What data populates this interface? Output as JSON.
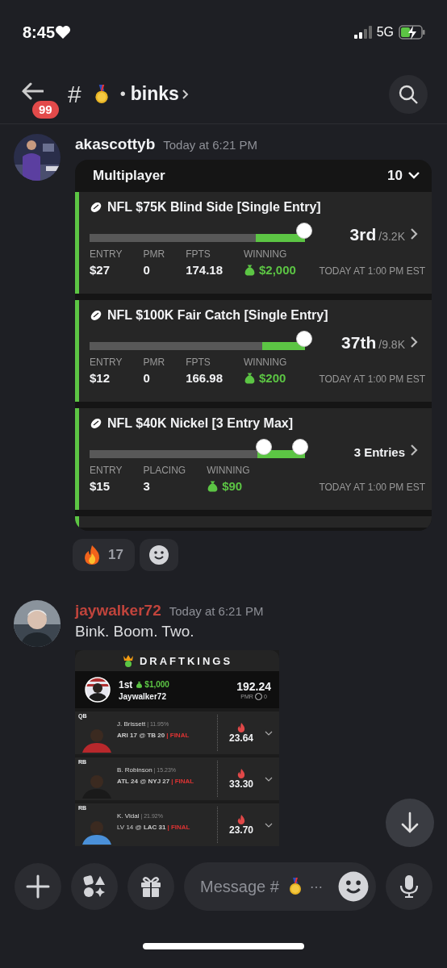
{
  "status_bar": {
    "time": "8:45",
    "network": "5G"
  },
  "header": {
    "unread_badge": "99",
    "hash": "#",
    "separator": "•",
    "channel": "binks"
  },
  "messages": [
    {
      "author": "akascottyb",
      "color": "#f2f3f5",
      "time": "Today at 6:21 PM",
      "kind": "contests",
      "contests_panel": {
        "title": "Multiplayer",
        "count": "10",
        "contests": [
          {
            "kind": "rank",
            "title": "NFL $75K Blind Side [Single Entry]",
            "level": 0.23,
            "rank": "3rd",
            "field": "/3.2K",
            "stats": [
              {
                "label": "ENTRY",
                "value": "$27",
                "kind": "plain"
              },
              {
                "label": "PMR",
                "value": "0",
                "kind": "plain"
              },
              {
                "label": "FPTS",
                "value": "174.18",
                "kind": "plain"
              },
              {
                "label": "WINNING",
                "value": "$2,000",
                "kind": "money"
              }
            ],
            "start": "TODAY AT 1:00 PM EST"
          },
          {
            "kind": "rank",
            "title": "NFL $100K Fair Catch [Single Entry]",
            "level": 0.2,
            "rank": "37th",
            "field": "/9.8K",
            "stats": [
              {
                "label": "ENTRY",
                "value": "$12",
                "kind": "plain"
              },
              {
                "label": "PMR",
                "value": "0",
                "kind": "plain"
              },
              {
                "label": "FPTS",
                "value": "166.98",
                "kind": "plain"
              },
              {
                "label": "WINNING",
                "value": "$200",
                "kind": "money"
              }
            ],
            "start": "TODAY AT 1:00 PM EST"
          },
          {
            "kind": "entries",
            "title": "NFL $40K Nickel [3 Entry Max]",
            "level": 0.22,
            "entries": "3 Entries",
            "stats": [
              {
                "label": "ENTRY",
                "value": "$15",
                "kind": "plain"
              },
              {
                "label": "PLACING",
                "value": "3",
                "kind": "plain"
              },
              {
                "label": "WINNING",
                "value": "$90",
                "kind": "money"
              }
            ],
            "start": "TODAY AT 1:00 PM EST"
          }
        ]
      },
      "reactions": [
        {
          "count": "17"
        }
      ]
    },
    {
      "author": "jaywalker72",
      "color": "#c1443c",
      "time": "Today at 6:21 PM",
      "kind": "lineup",
      "text": "Bink. Boom. Two.",
      "lineup": {
        "brand": "DRAFTKINGS",
        "place": "1st",
        "prize": "$1,000",
        "user": "Jaywalker72",
        "score": "192.24",
        "pmr_label": "PMR",
        "pmr": "0",
        "players": [
          {
            "position": "QB",
            "name": "J. Brissett",
            "owned": "| 11.95%",
            "game": "**ARI 17** @ **TB 20**",
            "status": "| FINAL",
            "points": "23.64"
          },
          {
            "position": "RB",
            "name": "B. Robinson",
            "owned": "| 15.23%",
            "game": "**ATL 24** @ **NYJ 27**",
            "status": "| FINAL",
            "points": "33.30"
          },
          {
            "position": "RB",
            "name": "K. Vidal",
            "owned": "| 21.92%",
            "game": "LV 14 @ **LAC 31**",
            "status": "| FINAL",
            "points": "23.70"
          }
        ]
      }
    }
  ],
  "composer": {
    "placeholder": "Message #",
    "ellipsis": "⋯"
  }
}
